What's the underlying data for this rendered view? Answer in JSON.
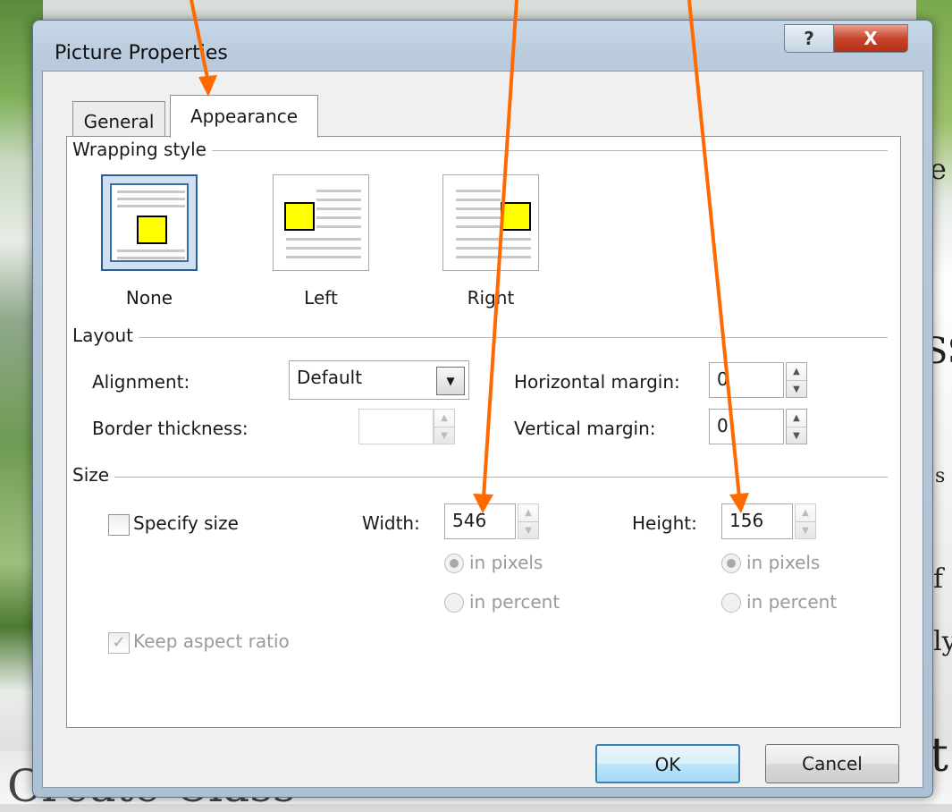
{
  "background": {
    "text_right_1": "e",
    "text_right_2": "SS",
    "text_right_3": "s",
    "text_right_4": "f",
    "text_right_5": "ly",
    "text_right_6": "t",
    "text_bottom": "Create Class"
  },
  "dialog": {
    "title": "Picture Properties",
    "help_glyph": "?",
    "close_glyph": "X"
  },
  "tabs": [
    {
      "label": "General",
      "selected": false
    },
    {
      "label": "Appearance",
      "selected": true
    }
  ],
  "wrapping": {
    "label": "Wrapping style",
    "options": [
      {
        "label": "None",
        "selected": true
      },
      {
        "label": "Left",
        "selected": false
      },
      {
        "label": "Right",
        "selected": false
      }
    ]
  },
  "layout": {
    "label": "Layout",
    "alignment_label": "Alignment:",
    "alignment_value": "Default",
    "border_label": "Border thickness:",
    "border_value": "",
    "hmargin_label": "Horizontal margin:",
    "hmargin_value": "0",
    "vmargin_label": "Vertical margin:",
    "vmargin_value": "0"
  },
  "size": {
    "label": "Size",
    "specify_label": "Specify size",
    "specify_checked": false,
    "width_label": "Width:",
    "width_value": "546",
    "height_label": "Height:",
    "height_value": "156",
    "in_pixels": "in pixels",
    "in_percent": "in percent",
    "keep_aspect_label": "Keep aspect ratio",
    "keep_aspect_checked": true
  },
  "buttons": {
    "ok": "OK",
    "cancel": "Cancel"
  },
  "colors": {
    "annotation_arrow": "#ff6a00",
    "selected_wrap": "#2c5d9a",
    "picture_fill": "#ffff00"
  }
}
